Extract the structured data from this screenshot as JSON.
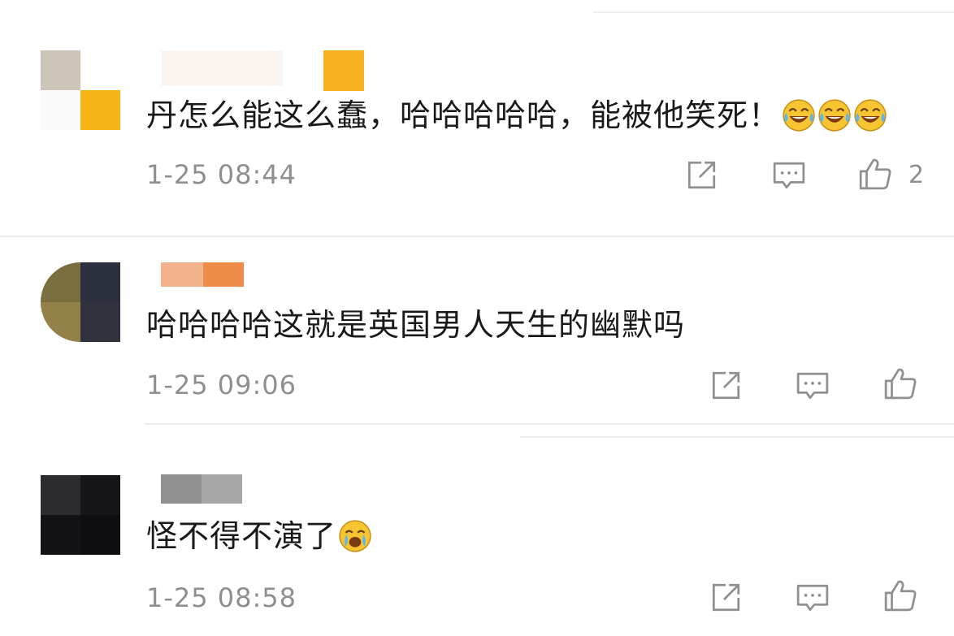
{
  "comments": [
    {
      "text": "丹怎么能这么蠢，哈哈哈哈哈，能被他笑死！",
      "emoji_count": 3,
      "emoji_icon": "laugh-cry-emoji",
      "time": "1-25 08:44",
      "likes": "2",
      "avatar_colors": [
        "#cdc6b8",
        "#ffffff",
        "#fafafb",
        "#f6b617"
      ]
    },
    {
      "text": "哈哈哈哈这就是英国男人天生的幽默吗",
      "emoji_count": 0,
      "time": "1-25 09:06",
      "likes": "",
      "avatar_colors": [
        "#7b6e3e",
        "#2c2f3e",
        "#94814a",
        "#30323e"
      ]
    },
    {
      "text": "怪不得不演了",
      "emoji_count": 1,
      "emoji_icon": "crying-emoji",
      "time": "1-25 08:58",
      "likes": "",
      "avatar_colors": [
        "#2b2b30",
        "#15151a",
        "#121216",
        "#0e0e12"
      ]
    }
  ],
  "actions": {
    "share_icon": "share-icon",
    "reply_icon": "reply-icon",
    "like_icon": "thumbs-up-icon"
  },
  "colors": {
    "text": "#1a1a1a",
    "meta": "#8f8f8f",
    "icon": "#909090",
    "divider": "#eeeeee"
  }
}
